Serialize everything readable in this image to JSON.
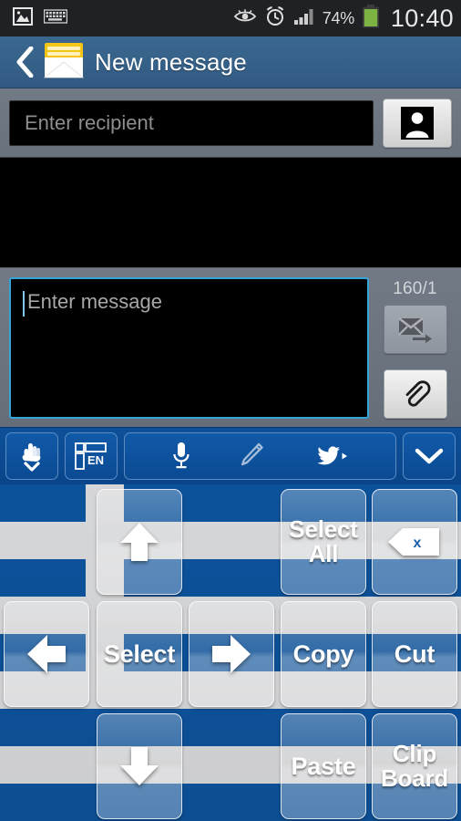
{
  "status_bar": {
    "icons_left": [
      "image-icon",
      "keyboard-icon"
    ],
    "icons_right": [
      "smart-stay-eye-icon",
      "alarm-clock-icon",
      "signal-bars-icon",
      "battery-icon"
    ],
    "battery_percent": "74%",
    "time": "10:40"
  },
  "header": {
    "back_label": "back-chevron",
    "app_icon": "envelope-icon",
    "title": "New message"
  },
  "recipient": {
    "placeholder": "Enter recipient",
    "value": "",
    "contacts_button": "contacts-icon"
  },
  "compose": {
    "placeholder": "Enter message",
    "value": "",
    "counter": "160/1",
    "send_button": "send-message-icon",
    "attach_button": "paperclip-icon"
  },
  "keyboard_toolbar": {
    "buttons": [
      {
        "name": "handwriting-input",
        "icon": "hand-down-icon"
      },
      {
        "name": "input-language",
        "icon": "keyboard-layout-icon",
        "label": "EN"
      },
      {
        "name": "voice-input",
        "icon": "microphone-icon"
      },
      {
        "name": "handwriting-pen",
        "icon": "pencil-icon"
      },
      {
        "name": "twitter-share",
        "icon": "twitter-bird-icon"
      },
      {
        "name": "hide-keyboard",
        "icon": "chevron-down-icon"
      }
    ]
  },
  "keypad": {
    "theme": "greek-flag",
    "colors": {
      "flag_blue": "#0d57a4",
      "flag_white": "#e3e4e6",
      "key_text": "#ffffff"
    },
    "keys": [
      {
        "id": "arrow-up",
        "label": "",
        "icon": "arrow-up-icon"
      },
      {
        "id": "select-all",
        "label": "Select All",
        "icon": ""
      },
      {
        "id": "backspace",
        "label": "",
        "icon": "backspace-icon"
      },
      {
        "id": "arrow-left",
        "label": "",
        "icon": "arrow-left-icon"
      },
      {
        "id": "select",
        "label": "Select",
        "icon": ""
      },
      {
        "id": "arrow-right",
        "label": "",
        "icon": "arrow-right-icon"
      },
      {
        "id": "copy",
        "label": "Copy",
        "icon": ""
      },
      {
        "id": "cut",
        "label": "Cut",
        "icon": ""
      },
      {
        "id": "arrow-down",
        "label": "",
        "icon": "arrow-down-icon"
      },
      {
        "id": "paste",
        "label": "Paste",
        "icon": ""
      },
      {
        "id": "clipboard",
        "label": "Clip Board",
        "icon": ""
      }
    ]
  }
}
